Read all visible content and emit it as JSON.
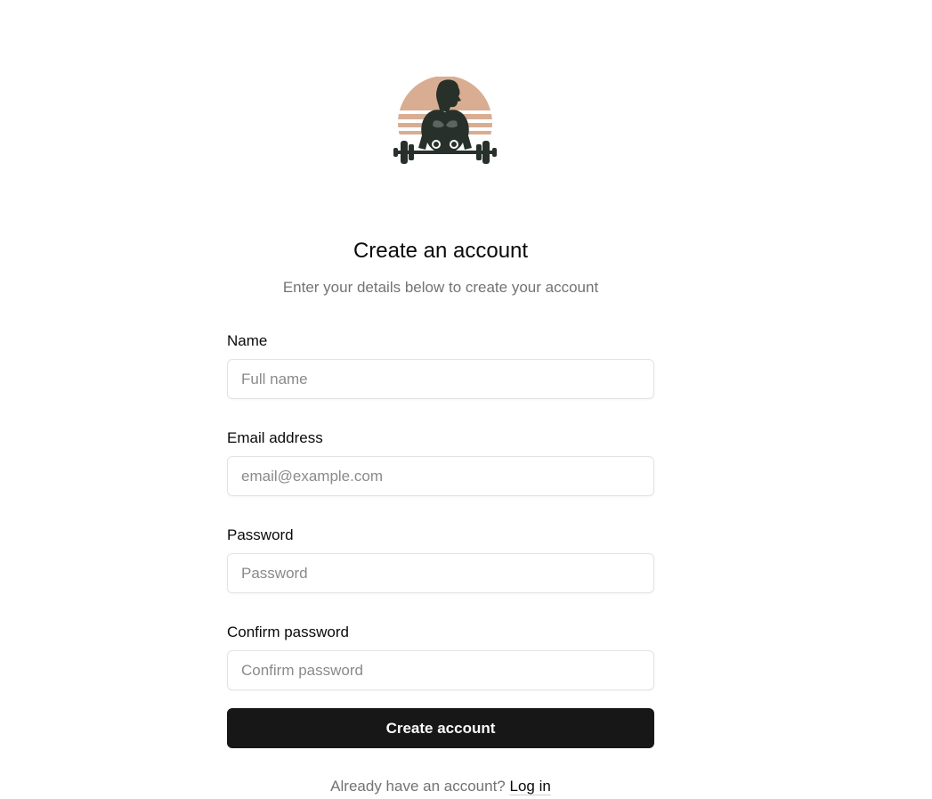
{
  "header": {
    "logo_icon": "bodybuilder-barbell-logo",
    "title": "Create an account",
    "subtitle": "Enter your details below to create your account"
  },
  "form": {
    "name": {
      "label": "Name",
      "placeholder": "Full name",
      "value": ""
    },
    "email": {
      "label": "Email address",
      "placeholder": "email@example.com",
      "value": ""
    },
    "password": {
      "label": "Password",
      "placeholder": "Password",
      "value": ""
    },
    "confirm_password": {
      "label": "Confirm password",
      "placeholder": "Confirm password",
      "value": ""
    },
    "submit_label": "Create account"
  },
  "footer": {
    "prompt": "Already have an account?",
    "login_link": "Log in"
  },
  "colors": {
    "logo_dark": "#28302a",
    "logo_tan": "#d8ad92",
    "button_bg": "#171717",
    "muted_text": "#737373"
  }
}
